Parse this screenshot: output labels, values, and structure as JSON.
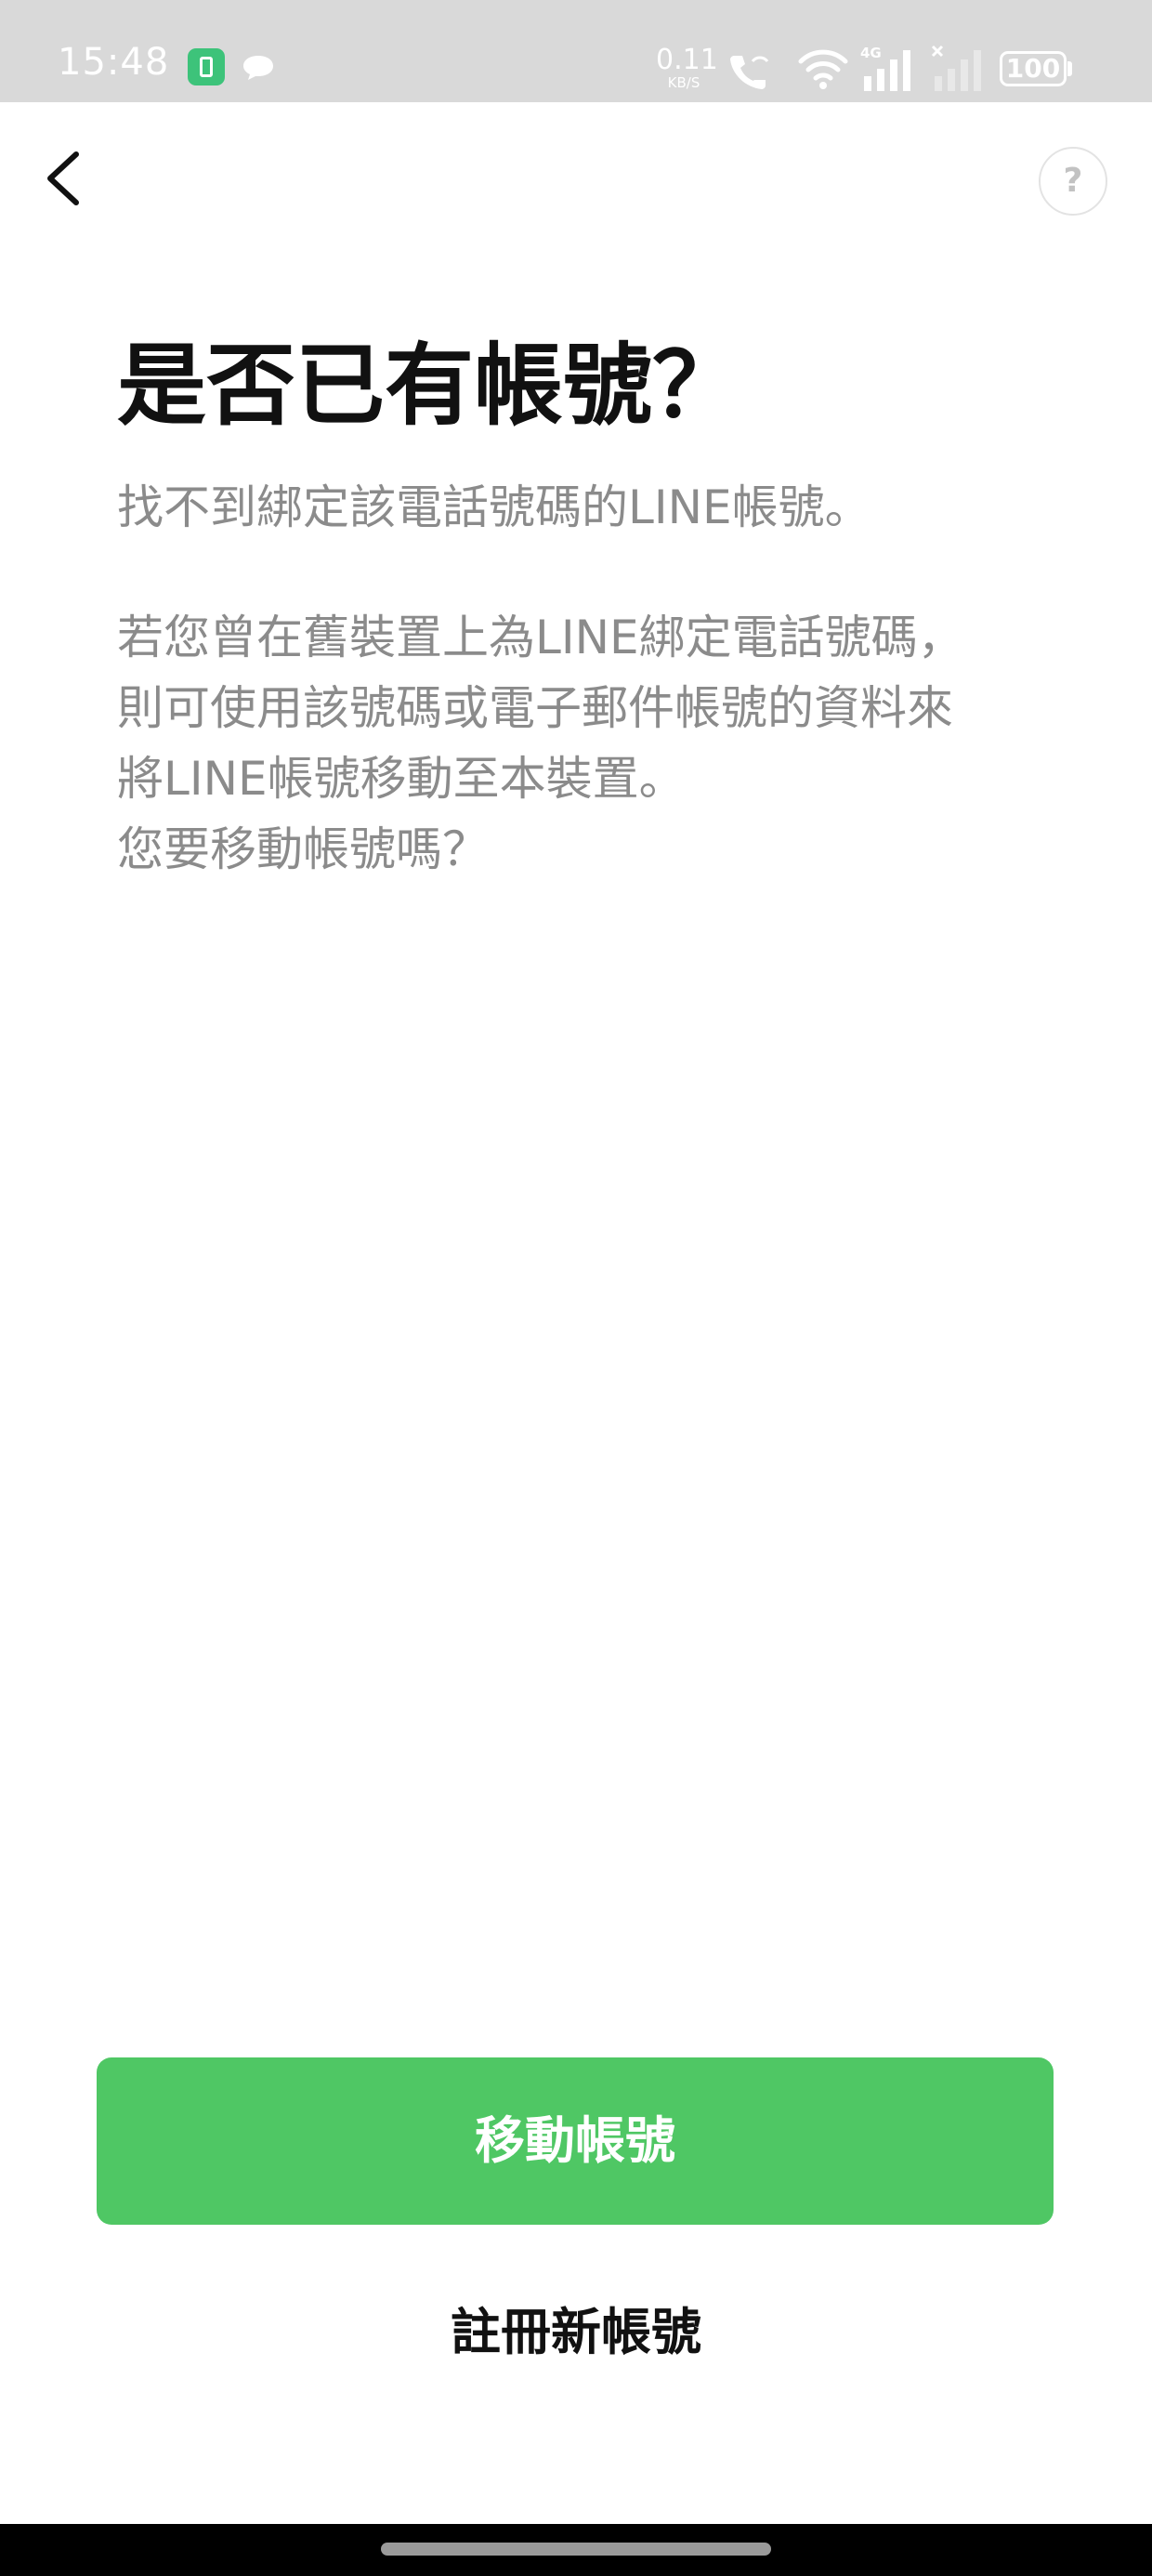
{
  "status_bar": {
    "time": "15:48",
    "net_speed_value": "0.11",
    "net_speed_unit": "KB/S",
    "network_type": "4G",
    "battery_level": "100",
    "icons": [
      "battery-saver-app-icon",
      "chat-bubble-icon",
      "wifi-call-icon",
      "wifi-icon",
      "signal-4g-icon",
      "signal-no-service-icon",
      "battery-icon"
    ]
  },
  "nav": {
    "back_icon": "chevron-left-icon",
    "help_label": "?"
  },
  "main": {
    "title": "是否已有帳號？",
    "subtitle": "找不到綁定該電話號碼的LINE帳號。",
    "body_lines": [
      "若您曾在舊裝置上為LINE綁定電話號碼，",
      "則可使用該號碼或電子郵件帳號的資料來",
      "將LINE帳號移動至本裝置。",
      "您要移動帳號嗎？"
    ]
  },
  "actions": {
    "primary_label": "移動帳號",
    "secondary_label": "註冊新帳號"
  },
  "colors": {
    "accent": "#4fc764",
    "status_bar_bg": "#d9d9d9",
    "secondary_text": "#8b8b8b",
    "title_text": "#111111"
  }
}
